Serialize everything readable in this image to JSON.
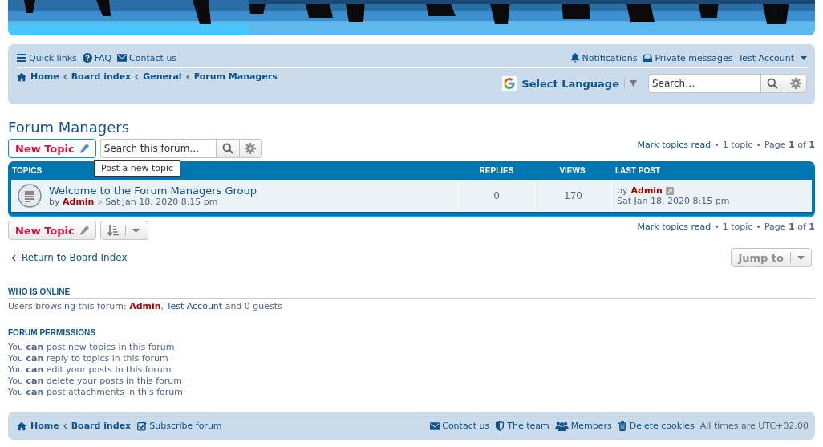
{
  "navbar": {
    "quick_links": [
      {
        "kind": "menu",
        "label": "Quick links"
      },
      {
        "kind": "help",
        "label": "FAQ"
      },
      {
        "kind": "mail",
        "label": "Contact us"
      }
    ],
    "user_links": [
      {
        "kind": "bell",
        "label": "Notifications"
      },
      {
        "kind": "inbox",
        "label": "Private messages"
      },
      {
        "kind": "account",
        "label": "Test Account"
      }
    ],
    "breadcrumbs": [
      "Home",
      "Board index",
      "General",
      "Forum Managers"
    ],
    "language": "Select Language",
    "search": {
      "placeholder": "Search…"
    }
  },
  "forum": {
    "title": "Forum Managers",
    "new_topic": "New Topic",
    "search": {
      "placeholder": "Search this forum…"
    },
    "tooltip": "Post a new topic",
    "pagination_top": {
      "mark_read": "Mark topics read",
      "separator": "•",
      "count": "1 topic",
      "separator_2": "•",
      "page": "Page **1** of **1**"
    }
  },
  "table": {
    "columns": [
      "TOPICS",
      "REPLIES",
      "VIEWS",
      "LAST POST"
    ],
    "rows": [
      {
        "title": "Welcome to the Forum Managers Group",
        "by": "by",
        "author": "Admin",
        "separator": "»",
        "date": "Sat Jan 18, 2020 8:15 pm",
        "replies": "0",
        "views": "170",
        "last_by": "by",
        "last_author": "Admin",
        "last_date": "Sat Jan 18, 2020 8:15 pm"
      }
    ]
  },
  "bottom_bar": {
    "new_topic": "New Topic",
    "pagination": {
      "mark_read": "Mark topics read",
      "separator": "•",
      "count": "1 topic",
      "separator_2": "•",
      "page": "Page **1** of **1**"
    }
  },
  "return_link": "Return to Board Index",
  "jump_to": "Jump to",
  "who_is_online": {
    "heading": "WHO IS ONLINE",
    "prefix": "Users browsing this forum:",
    "users": [
      {
        "name": "Admin",
        "color": "#aa0000",
        "separator": ","
      },
      {
        "name": "Test Account",
        "color": "#105289"
      }
    ],
    "suffix": "and 0 guests"
  },
  "permissions": {
    "heading": "FORUM PERMISSIONS",
    "lines": [
      "You **can** post new topics in this forum",
      "You **can** reply to topics in this forum",
      "You **can** edit your posts in this forum",
      "You **can** delete your posts in this forum",
      "You **can** post attachments in this forum"
    ]
  },
  "footer": {
    "breadcrumbs": [
      "Home",
      "Board index"
    ],
    "subscribe": "Subscribe forum",
    "links": [
      {
        "kind": "mail",
        "label": "Contact us"
      },
      {
        "kind": "shield",
        "label": "The team"
      },
      {
        "kind": "users",
        "label": "Members"
      },
      {
        "kind": "trash",
        "label": "Delete cookies"
      }
    ],
    "timezone": "All times are UTC+02:00"
  }
}
